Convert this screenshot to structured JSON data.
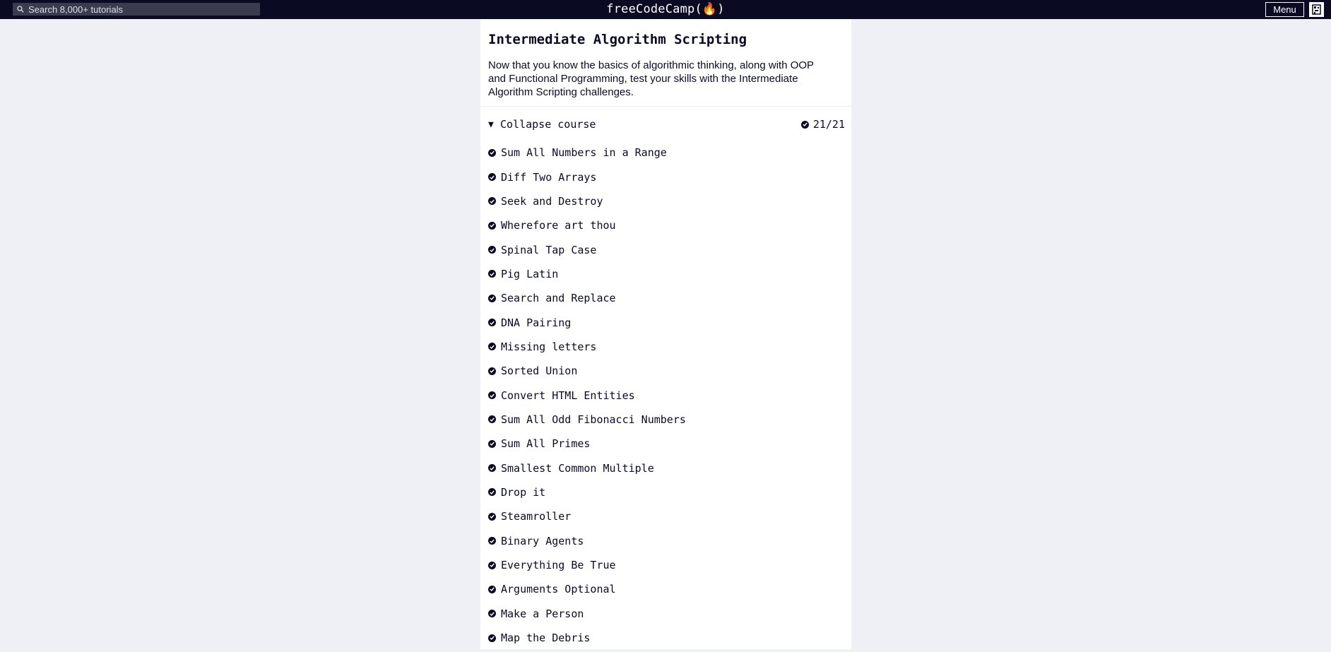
{
  "navbar": {
    "search_placeholder": "Search 8,000+ tutorials",
    "logo_text": "freeCodeCamp(🔥)",
    "menu_label": "Menu",
    "colors": {
      "background": "#0a0a23",
      "search_bg": "#3b3b4f",
      "text": "#ffffff"
    }
  },
  "course": {
    "title": "Intermediate Algorithm Scripting",
    "intro": "Now that you know the basics of algorithmic thinking, along with OOP and Functional Programming, test your skills with the Intermediate Algorithm Scripting challenges.",
    "toggle_label": "Collapse course",
    "toggle_icon": "triangle-down-icon",
    "progress": "21/21",
    "challenges": [
      "Sum All Numbers in a Range",
      "Diff Two Arrays",
      "Seek and Destroy",
      "Wherefore art thou",
      "Spinal Tap Case",
      "Pig Latin",
      "Search and Replace",
      "DNA Pairing",
      "Missing letters",
      "Sorted Union",
      "Convert HTML Entities",
      "Sum All Odd Fibonacci Numbers",
      "Sum All Primes",
      "Smallest Common Multiple",
      "Drop it",
      "Steamroller",
      "Binary Agents",
      "Everything Be True",
      "Arguments Optional",
      "Make a Person",
      "Map the Debris"
    ],
    "completed_icon": "check-circle-icon",
    "colors": {
      "page_bg": "#eef0f5",
      "card_bg": "#ffffff",
      "text": "#0a0a23"
    }
  }
}
